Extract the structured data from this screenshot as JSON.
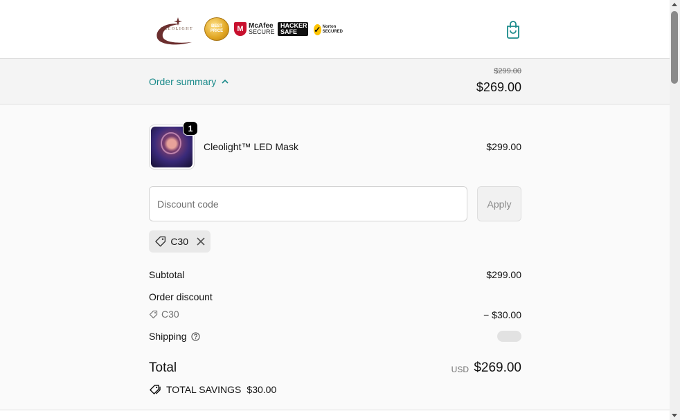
{
  "header": {
    "logo_text": "CLEOLIGHT",
    "badges": {
      "gold_text": "BEST PRICE",
      "mcafee_brand": "McAfee",
      "mcafee_sub": "SECURE",
      "hacker_top": "HACKER",
      "hacker_bottom": "SAFE",
      "norton_brand": "Norton",
      "norton_sub": "SECURED"
    },
    "cart_icon": "shopping-bag-icon"
  },
  "summary": {
    "toggle_label": "Order summary",
    "toggle_icon": "chevron-up-icon",
    "original_total": "$299.00",
    "total": "$269.00"
  },
  "line_item": {
    "quantity": "1",
    "name": "Cleolight™ LED Mask",
    "price": "$299.00"
  },
  "discount": {
    "placeholder": "Discount code",
    "apply_label": "Apply",
    "applied_code": "C30"
  },
  "totals": {
    "subtotal_label": "Subtotal",
    "subtotal_value": "$299.00",
    "order_discount_label": "Order discount",
    "discount_code": "C30",
    "discount_value": "− $30.00",
    "shipping_label": "Shipping",
    "total_label": "Total",
    "currency": "USD",
    "total_value": "$269.00",
    "savings_label": "TOTAL SAVINGS",
    "savings_value": "$30.00"
  },
  "colors": {
    "accent": "#1a8a8a",
    "background": "#fafafa",
    "summary_bar": "#f4f4f4"
  }
}
